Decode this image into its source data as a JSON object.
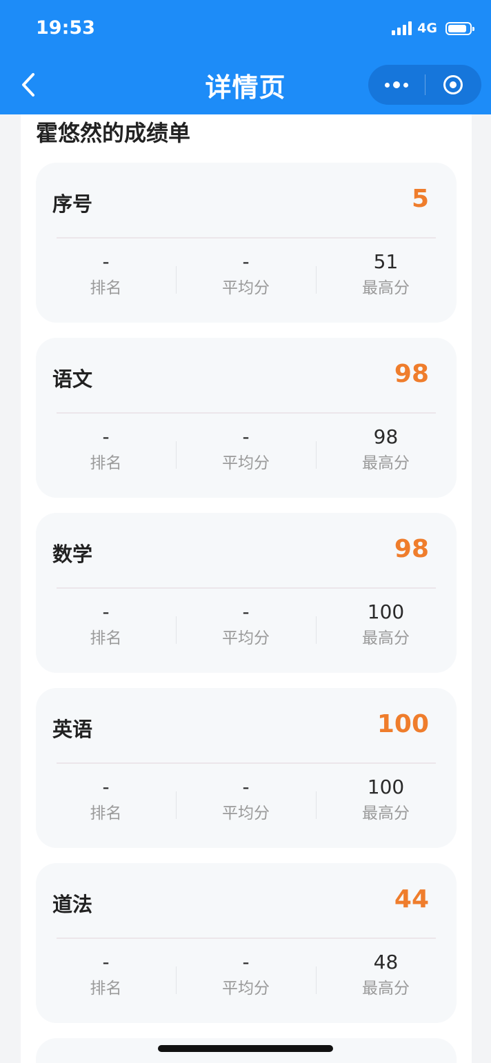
{
  "status_bar": {
    "time": "19:53",
    "network": "4G"
  },
  "nav": {
    "title": "详情页"
  },
  "page": {
    "heading": "霍悠然的成绩单"
  },
  "stat_labels": {
    "rank": "排名",
    "average": "平均分",
    "highest": "最高分"
  },
  "cards": [
    {
      "subject": "序号",
      "score": "5",
      "rank": "-",
      "average": "-",
      "highest": "51"
    },
    {
      "subject": "语文",
      "score": "98",
      "rank": "-",
      "average": "-",
      "highest": "98"
    },
    {
      "subject": "数学",
      "score": "98",
      "rank": "-",
      "average": "-",
      "highest": "100"
    },
    {
      "subject": "英语",
      "score": "100",
      "rank": "-",
      "average": "-",
      "highest": "100"
    },
    {
      "subject": "道法",
      "score": "44",
      "rank": "-",
      "average": "-",
      "highest": "48"
    }
  ],
  "colors": {
    "header": "#1d8cf8",
    "score": "#ef7d2c"
  },
  "icons": [
    "signal-icon",
    "battery-icon",
    "back-arrow-icon",
    "more-dots-icon",
    "close-target-icon"
  ]
}
